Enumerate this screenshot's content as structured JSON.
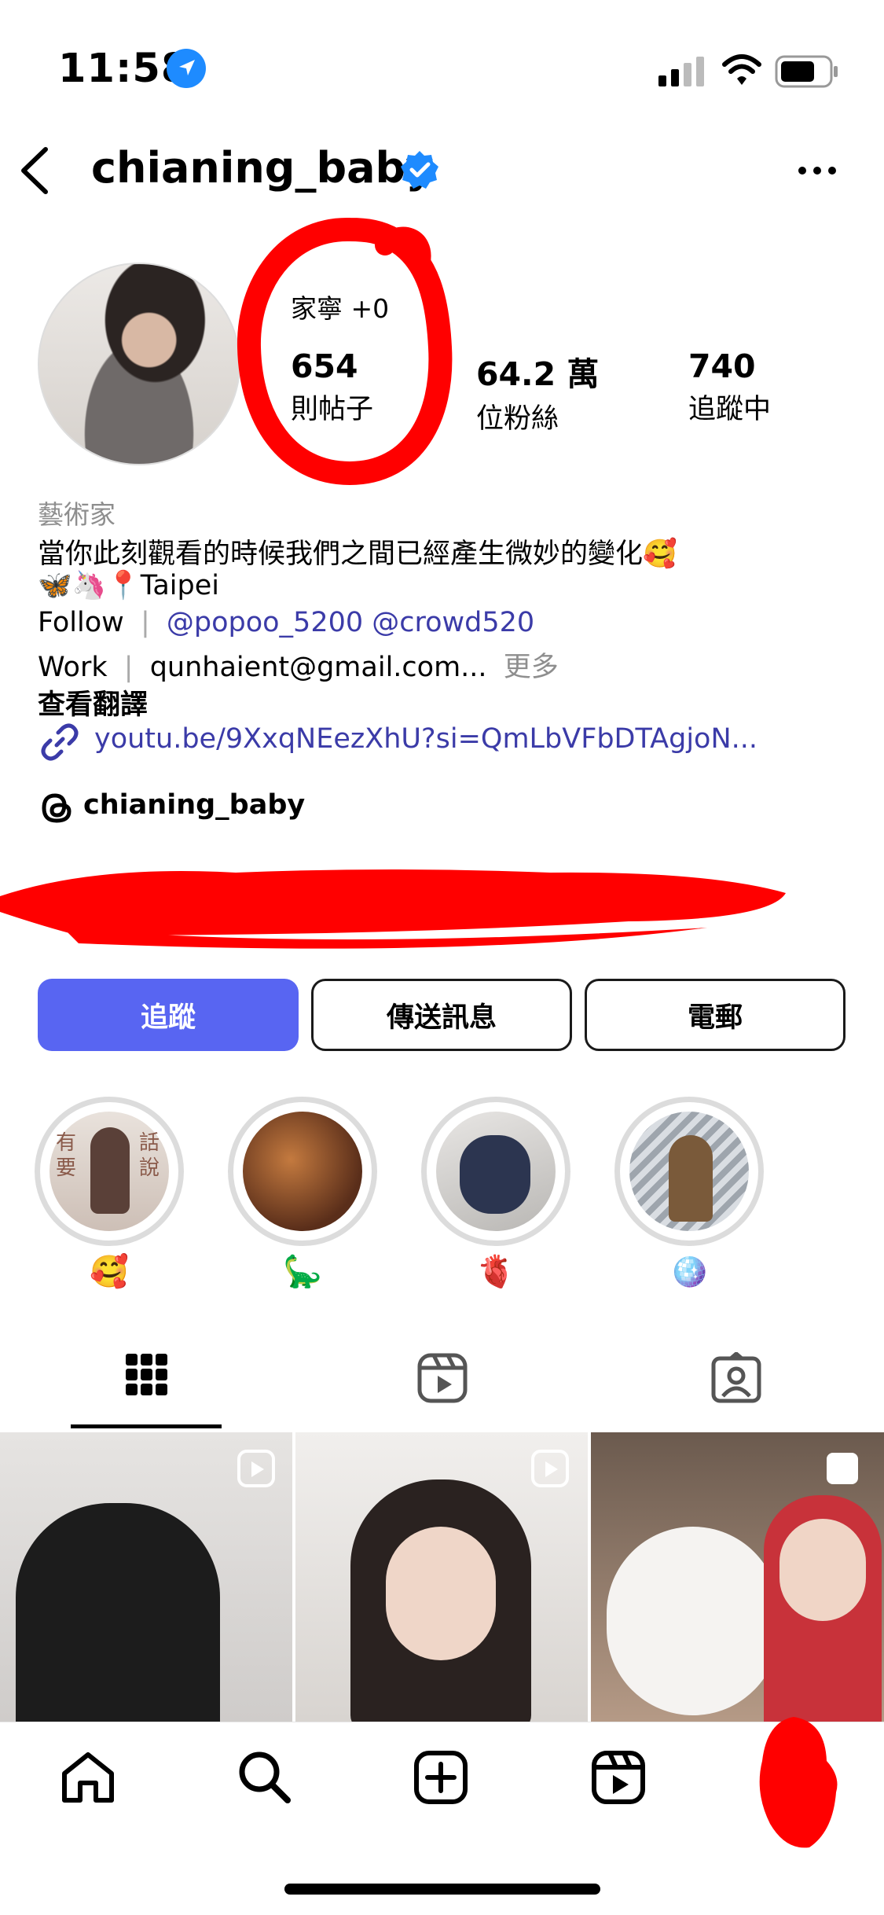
{
  "status_bar": {
    "time": "11:58"
  },
  "header": {
    "username": "chianing_baby"
  },
  "profile": {
    "mutual_text": "家寧 +0",
    "stats": [
      {
        "value": "654",
        "label": "則帖子"
      },
      {
        "value": "64.2 萬",
        "label": "位粉絲"
      },
      {
        "value": "740",
        "label": "追蹤中"
      }
    ]
  },
  "bio": {
    "category": "藝術家",
    "line1": "當你此刻觀看的時候我們之間已經產生微妙的變化🥰",
    "line2": "🦋🦄📍Taipei",
    "follow_label": "Follow",
    "follow_handles": "@popoo_5200 @crowd520",
    "work_label": "Work",
    "work_email": "qunhaient@gmail.com...",
    "more": "更多",
    "translate": "查看翻譯",
    "link": "youtu.be/9XxqNEezXhU?si=QmLbVFbDTAgjoN...",
    "threads_handle": "chianing_baby"
  },
  "buttons": {
    "follow": "追蹤",
    "message": "傳送訊息",
    "email": "電郵"
  },
  "highlights": [
    {
      "emoji": "🥰",
      "overlay_left": "有要",
      "overlay_right": "話說"
    },
    {
      "emoji": "🦕"
    },
    {
      "emoji": "🫀"
    },
    {
      "emoji": "🪩"
    }
  ],
  "tabs": [
    "grid-tab",
    "reels-tab",
    "tagged-tab"
  ],
  "colors": {
    "accent": "#5865f2",
    "link": "#3b3ba8",
    "verified": "#1e8bff",
    "redaction": "#ff0000"
  }
}
